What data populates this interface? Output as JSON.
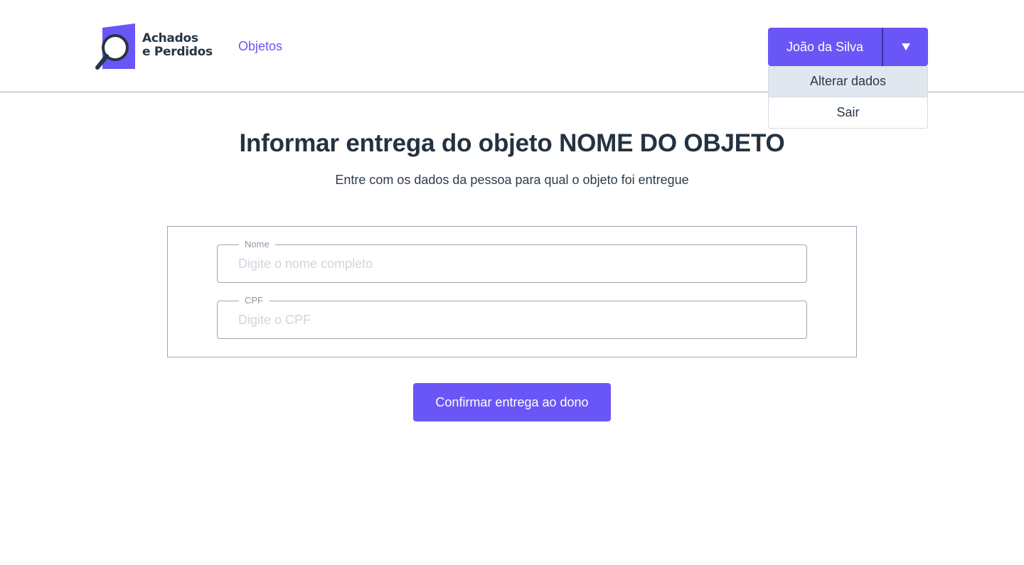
{
  "brand": {
    "name_line1": "Achados",
    "name_line2": "e Perdidos",
    "logo_icon": "magnifier-on-tag-icon",
    "accent_color": "#6a56f6"
  },
  "nav": {
    "objetos_label": "Objetos"
  },
  "user_menu": {
    "user_name": "João da Silva",
    "toggle_icon": "caret-down-icon",
    "items": [
      {
        "label": "Alterar dados",
        "highlighted": true
      },
      {
        "label": "Sair",
        "highlighted": false
      }
    ]
  },
  "page": {
    "title": "Informar entrega do objeto NOME DO OBJETO",
    "subtitle": "Entre com os dados da pessoa para qual o objeto foi entregue"
  },
  "form": {
    "nome": {
      "label": "Nome",
      "placeholder": "Digite o nome completo",
      "value": ""
    },
    "cpf": {
      "label": "CPF",
      "placeholder": "Digite o CPF",
      "value": ""
    },
    "submit_label": "Confirmar entrega ao dono"
  }
}
